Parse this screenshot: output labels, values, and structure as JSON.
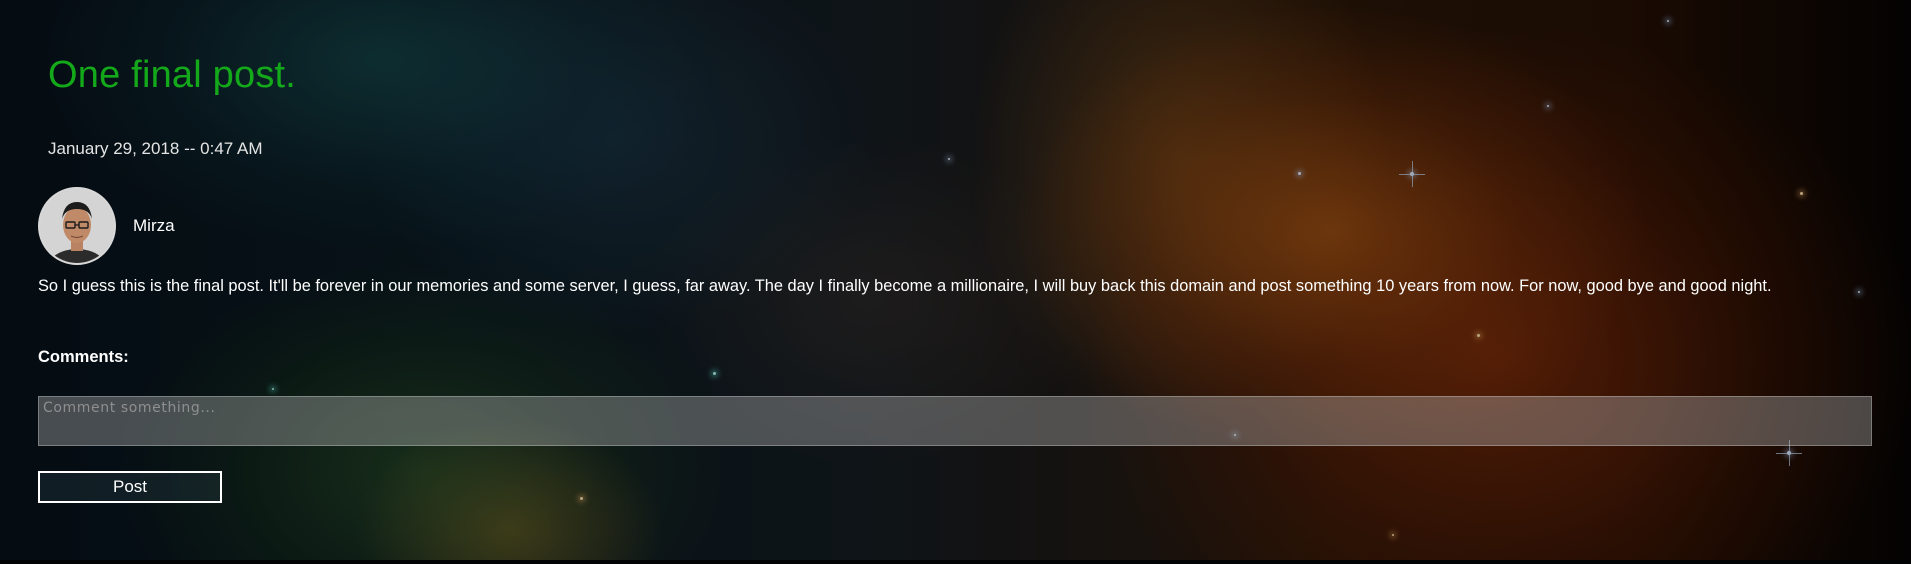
{
  "post": {
    "title": "One final post.",
    "date": "January 29, 2018 -- 0:47 AM",
    "author": {
      "name": "Mirza"
    },
    "body": "So I guess this is the final post. It'll be forever in our memories and some server, I guess, far away. The day I finally become a millionaire, I will buy back this domain and post something 10 years from now. For now, good bye and good night."
  },
  "comments": {
    "heading": "Comments:",
    "placeholder": "Comment something...",
    "post_label": "Post"
  },
  "colors": {
    "title": "#14a91a",
    "text": "#ffffff"
  }
}
